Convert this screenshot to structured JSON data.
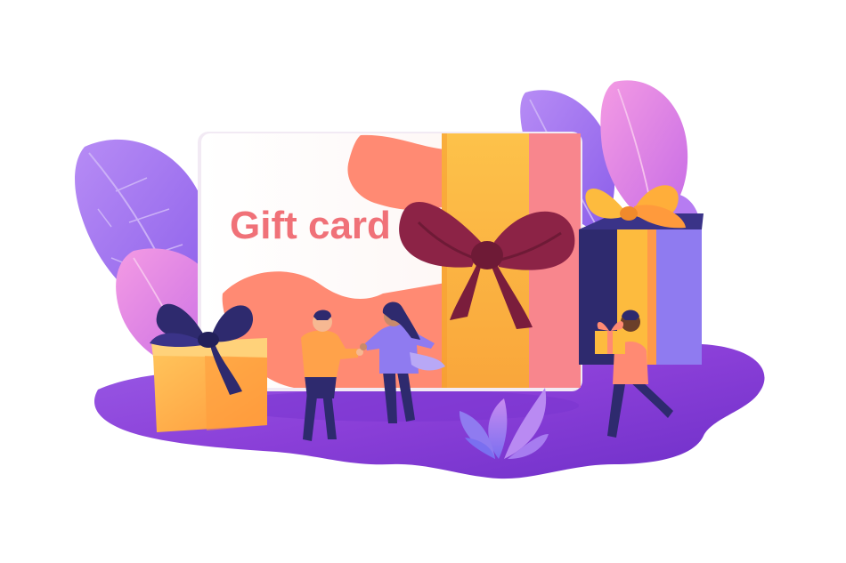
{
  "illustration": {
    "card_text": "Gift card",
    "colors": {
      "card_text": "#F07178",
      "ground": "#8A3FD8",
      "leaf_purple": "#9B6CF0",
      "leaf_pink": "#E27BE4",
      "ribbon_orange": "#FDBB3E",
      "bow_maroon": "#8C2346",
      "box_orange": "#FFB347",
      "box_navy": "#2E2A6E",
      "coral": "#FF8A73"
    },
    "icons": [
      "leaf-icon",
      "gift-box-icon",
      "bow-icon",
      "person-icon",
      "plant-icon"
    ]
  }
}
